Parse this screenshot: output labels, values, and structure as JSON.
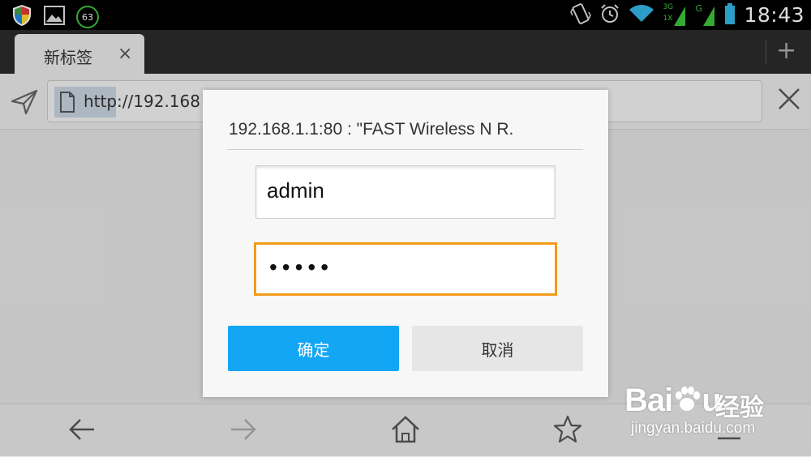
{
  "status_bar": {
    "time": "18:43",
    "notification_count": "63",
    "network_3g": "3G",
    "network_1x": "1X",
    "network_g": "G",
    "icons": [
      "shield-icon",
      "gallery-icon",
      "vibrate-icon",
      "alarm-icon",
      "wifi-icon",
      "signal-icon",
      "battery-icon"
    ]
  },
  "tab_bar": {
    "tabs": [
      {
        "label": "新标签",
        "close": "×"
      }
    ],
    "new_tab": "+"
  },
  "address_bar": {
    "url": "http://192.168"
  },
  "dialog": {
    "title": "192.168.1.1:80 : \"FAST Wireless N R.",
    "username_value": "admin",
    "password_value": "•••••",
    "ok_label": "确定",
    "cancel_label": "取消",
    "focus_color": "#f39b1a",
    "ok_color": "#13a6f5"
  },
  "bottom_nav": {
    "icons": [
      "back-icon",
      "forward-icon",
      "home-icon",
      "bookmark-star-icon",
      "menu-icon"
    ]
  },
  "watermark": {
    "brand_latin": "Bai",
    "brand_latin_end": "u",
    "brand_cn": "经验",
    "url": "jingyan.baidu.com"
  }
}
